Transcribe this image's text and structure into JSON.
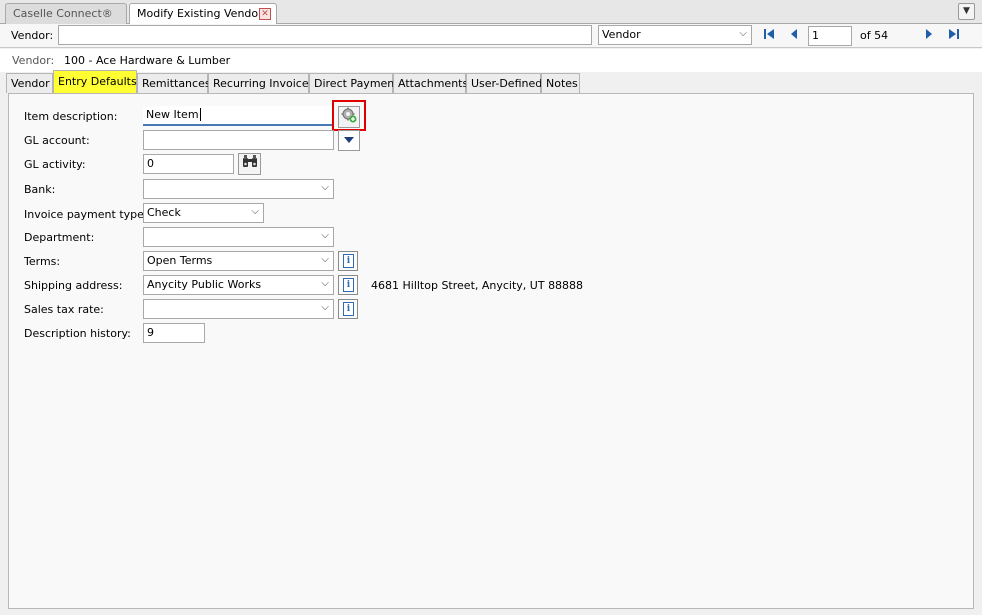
{
  "tabs": {
    "caselle": "Caselle Connect®",
    "modify": "Modify Existing Vendors",
    "close_glyph": "✕"
  },
  "nav": {
    "vendor_label": "Vendor:",
    "vendor_input": "",
    "search_by": "Vendor",
    "record": "1",
    "of_total": "of 54"
  },
  "vendor_info": {
    "label": "Vendor:",
    "value": "100  - Ace Hardware & Lumber"
  },
  "inner_tabs": [
    "Vendor",
    "Entry Defaults",
    "Remittances",
    "Recurring Invoices",
    "Direct Payment",
    "Attachments",
    "User-Defined",
    "Notes"
  ],
  "active_inner_tab": "Entry Defaults",
  "form": {
    "item_description": {
      "label": "Item description:",
      "value": "New Item"
    },
    "gl_account": {
      "label": "GL account:",
      "value": ""
    },
    "gl_activity": {
      "label": "GL activity:",
      "value": "0"
    },
    "bank": {
      "label": "Bank:",
      "value": ""
    },
    "invoice_payment_type": {
      "label": "Invoice payment type:",
      "value": "Check"
    },
    "department": {
      "label": "Department:",
      "value": ""
    },
    "terms": {
      "label": "Terms:",
      "value": "Open Terms"
    },
    "shipping_address": {
      "label": "Shipping address:",
      "value": "Anycity Public Works",
      "address_text": "4681 Hilltop Street, Anycity, UT 88888"
    },
    "sales_tax_rate": {
      "label": "Sales tax rate:",
      "value": ""
    },
    "description_history": {
      "label": "Description history:",
      "value": "9"
    }
  },
  "colors": {
    "active_tab_bg": "#ffff33",
    "highlight_border": "#e00000",
    "nav_arrow": "#1f5ea8"
  }
}
